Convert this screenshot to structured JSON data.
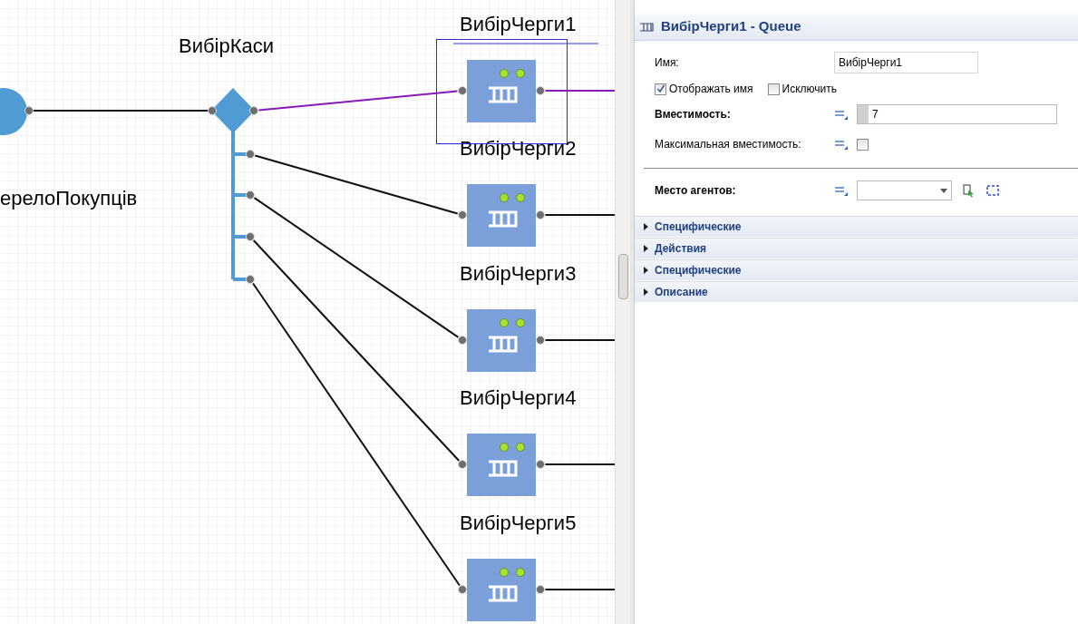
{
  "canvas": {
    "source": {
      "label": "ерелоПокупців"
    },
    "select_output": {
      "label": "ВибірКаси"
    },
    "queues": [
      {
        "label": "ВибірЧерги1",
        "selected": true
      },
      {
        "label": "ВибірЧерги2",
        "selected": false
      },
      {
        "label": "ВибірЧерги3",
        "selected": false
      },
      {
        "label": "ВибірЧерги4",
        "selected": false
      },
      {
        "label": "ВибірЧерги5",
        "selected": false
      }
    ]
  },
  "properties": {
    "title": "ВибірЧерги1 - Queue",
    "name_field": {
      "label": "Имя:",
      "value": "ВибірЧерги1"
    },
    "checkboxes": [
      {
        "label": "Отображать имя",
        "checked": true
      },
      {
        "label": "Исключить",
        "checked": false
      }
    ],
    "capacity": {
      "label": "Вместимость:",
      "value": "7"
    },
    "max_capacity": {
      "label": "Максимальная вместимость:",
      "checked": false
    },
    "agent_location": {
      "label": "Место агентов:"
    },
    "sections": [
      {
        "label": "Специфические",
        "expanded": false
      },
      {
        "label": "Действия",
        "expanded": false
      },
      {
        "label": "Специфические",
        "expanded": false
      },
      {
        "label": "Описание",
        "expanded": false
      }
    ]
  }
}
